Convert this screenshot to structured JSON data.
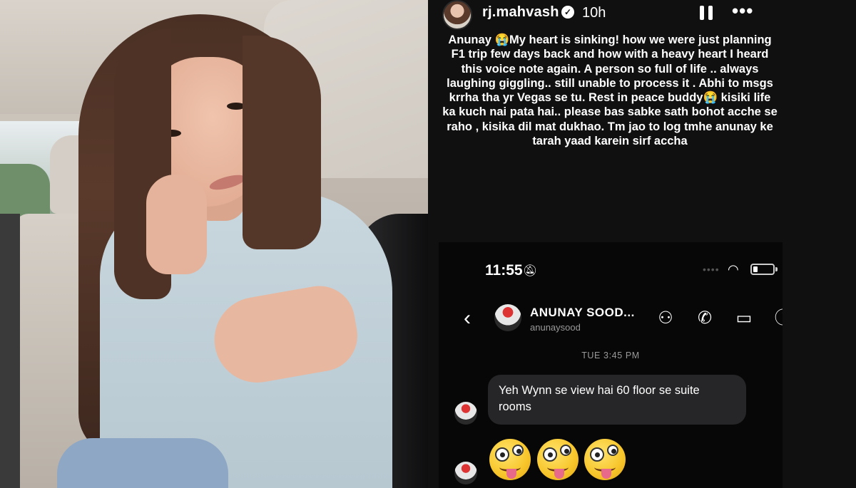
{
  "story": {
    "username": "rj.mahvash",
    "time_ago": "10h",
    "caption": "Anunay 😭My heart is sinking! how  we were just planning F1 trip few days back and how with a heavy heart I heard this voice note again. A person so full of life .. always laughing giggling.. still unable to process it . Abhi to msgs krrha tha yr Vegas se tu. Rest in peace buddy😭 kisiki life ka kuch nai pata hai.. please bas sabke sath bohot acche se raho , kisika dil mat dukhao. Tm jao to log tmhe anunay ke tarah yaad karein sirf accha"
  },
  "dm_screenshot": {
    "status_bar": {
      "time": "11:55"
    },
    "header": {
      "name": "ANUNAY SOOD...",
      "handle": "anunaysood"
    },
    "date_stamp": "TUE 3:45 PM",
    "message": "Yeh Wynn se view hai 60 floor se suite rooms",
    "emoji_reaction": "🤪🤪🤪"
  },
  "icons": {
    "verified": "verified-badge-icon",
    "pause": "pause-icon",
    "more": "more-options-icon",
    "mute": "bell-off-icon",
    "wifi": "wifi-icon",
    "battery": "battery-icon",
    "back": "back-arrow-icon",
    "effects": "effects-icon",
    "call": "phone-icon",
    "video": "video-camera-icon",
    "info": "info-icon"
  }
}
